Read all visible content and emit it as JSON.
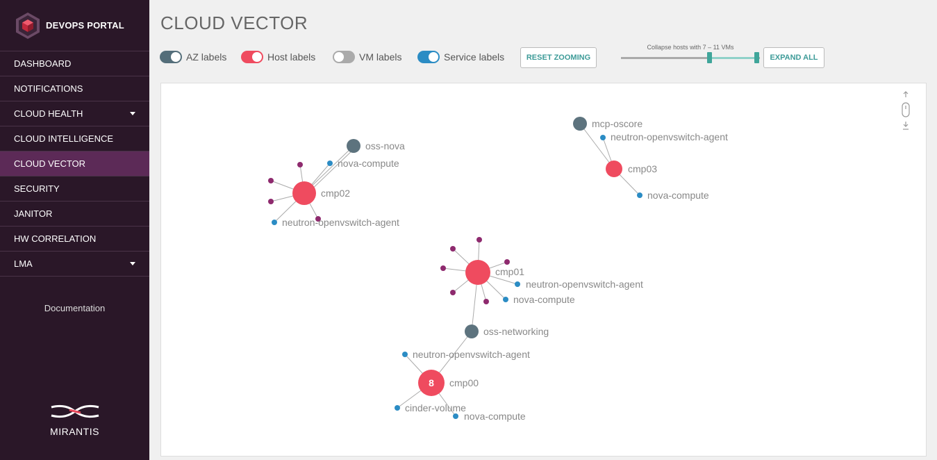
{
  "brand": {
    "title": "DEVOPS PORTAL",
    "logo_icon": "cube-hexagon-icon"
  },
  "sidebar": {
    "items": [
      {
        "label": "DASHBOARD",
        "active": false,
        "dropdown": false
      },
      {
        "label": "NOTIFICATIONS",
        "active": false,
        "dropdown": false
      },
      {
        "label": "CLOUD HEALTH",
        "active": false,
        "dropdown": true
      },
      {
        "label": "CLOUD INTELLIGENCE",
        "active": false,
        "dropdown": false
      },
      {
        "label": "CLOUD VECTOR",
        "active": true,
        "dropdown": false
      },
      {
        "label": "SECURITY",
        "active": false,
        "dropdown": false
      },
      {
        "label": "JANITOR",
        "active": false,
        "dropdown": false
      },
      {
        "label": "HW CORRELATION",
        "active": false,
        "dropdown": false
      },
      {
        "label": "LMA",
        "active": false,
        "dropdown": true
      }
    ],
    "documentation": "Documentation",
    "footer_brand": "MIRANTIS"
  },
  "page": {
    "title": "CLOUD VECTOR"
  },
  "toolbar": {
    "toggles": [
      {
        "label": "AZ labels",
        "on": true,
        "color": "#546e7a"
      },
      {
        "label": "Host labels",
        "on": true,
        "color": "#ef4b5f"
      },
      {
        "label": "VM labels",
        "on": false,
        "color": "#aaaaaa"
      },
      {
        "label": "Service labels",
        "on": true,
        "color": "#2b8cc4"
      }
    ],
    "reset_zooming": "RESET ZOOMING",
    "slider": {
      "caption": "Collapse hosts with 7 – 11 VMs",
      "min_value": 7,
      "max_value": 11
    },
    "expand_all": "EXPAND ALL"
  },
  "colors": {
    "az": "#5d737e",
    "host": "#ef4b5f",
    "vm": "#8e2a6e",
    "service": "#2b8cc4",
    "edge": "#aaaaaa",
    "label": "#888888"
  },
  "graph": {
    "az_nodes": [
      {
        "id": "oss-nova",
        "label": "oss-nova"
      },
      {
        "id": "mcp-oscore",
        "label": "mcp-oscore"
      },
      {
        "id": "oss-networking",
        "label": "oss-networking"
      }
    ],
    "hosts": [
      {
        "id": "cmp02",
        "label": "cmp02",
        "count": ""
      },
      {
        "id": "cmp03",
        "label": "cmp03",
        "count": ""
      },
      {
        "id": "cmp01",
        "label": "cmp01",
        "count": ""
      },
      {
        "id": "cmp00",
        "label": "cmp00",
        "count": "8"
      }
    ],
    "services": [
      {
        "id": "s1",
        "label": "nova-compute"
      },
      {
        "id": "s2",
        "label": "neutron-openvswitch-agent"
      },
      {
        "id": "s3",
        "label": "neutron-openvswitch-agent"
      },
      {
        "id": "s4",
        "label": "nova-compute"
      },
      {
        "id": "s5",
        "label": "neutron-openvswitch-agent"
      },
      {
        "id": "s6",
        "label": "nova-compute"
      },
      {
        "id": "s7",
        "label": "neutron-openvswitch-agent"
      },
      {
        "id": "s8",
        "label": "cinder-volume"
      },
      {
        "id": "s9",
        "label": "nova-compute"
      }
    ]
  }
}
